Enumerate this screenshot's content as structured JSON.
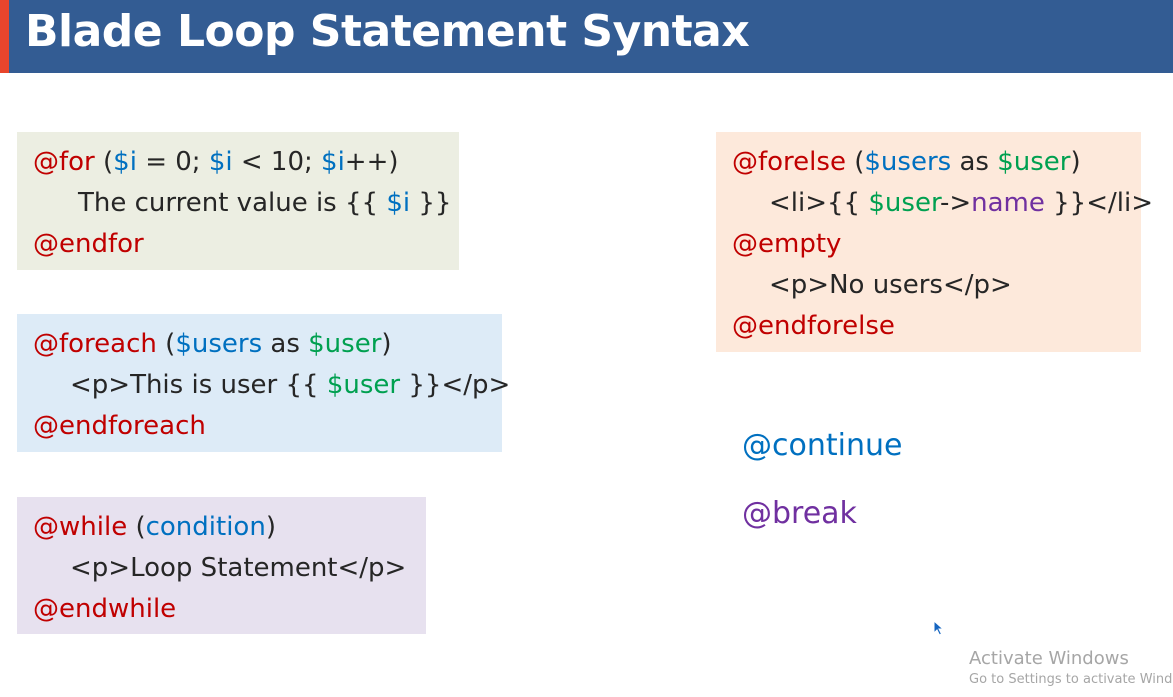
{
  "header": {
    "title": "Blade Loop Statement Syntax"
  },
  "for_block": {
    "open_kw": "@for",
    "open_paren": " (",
    "var_i1": "$i",
    "eq_zero": " = 0; ",
    "var_i2": "$i",
    "lt_ten": " < 10; ",
    "var_i3": "$i",
    "plus_close": "++)",
    "body_text": "The current value is {{ ",
    "body_var": "$i",
    "body_close": " }}",
    "close_kw": "@endfor"
  },
  "foreach_block": {
    "open_kw": "@foreach",
    "open_paren": " (",
    "var_users": "$users",
    "as": " as ",
    "var_user": "$user",
    "close_paren": ")",
    "body_text": "<p>This is user {{ ",
    "body_var": "$user",
    "body_close": " }}</p>",
    "close_kw": "@endforeach"
  },
  "while_block": {
    "open_kw": "@while",
    "open_paren": " (",
    "condition": "condition",
    "close_paren": ")",
    "body_text": "<p>Loop Statement</p>",
    "close_kw": "@endwhile"
  },
  "forelse_block": {
    "open_kw": "@forelse",
    "open_paren": " (",
    "var_users": "$users",
    "as": " as ",
    "var_user": "$user",
    "close_paren": ")",
    "li_open": "<li>{{ ",
    "li_var": "$user",
    "li_arrow": "->",
    "li_prop": "name",
    "li_close": " }}</li>",
    "empty_kw": "@empty",
    "empty_body": "<p>No users</p>",
    "close_kw": "@endforelse"
  },
  "directives": {
    "continue": "@continue",
    "break": "@break"
  },
  "watermark": {
    "line1": "Activate Windows",
    "line2": "Go to Settings to activate Windc"
  },
  "colors": {
    "header_bg": "#335c93",
    "header_accent": "#e8452c",
    "keyword": "#c00000",
    "variable_blue": "#0070c0",
    "variable_green": "#00a050",
    "property_purple": "#7030a0"
  },
  "icons": {
    "cursor": "mouse-pointer-icon"
  }
}
